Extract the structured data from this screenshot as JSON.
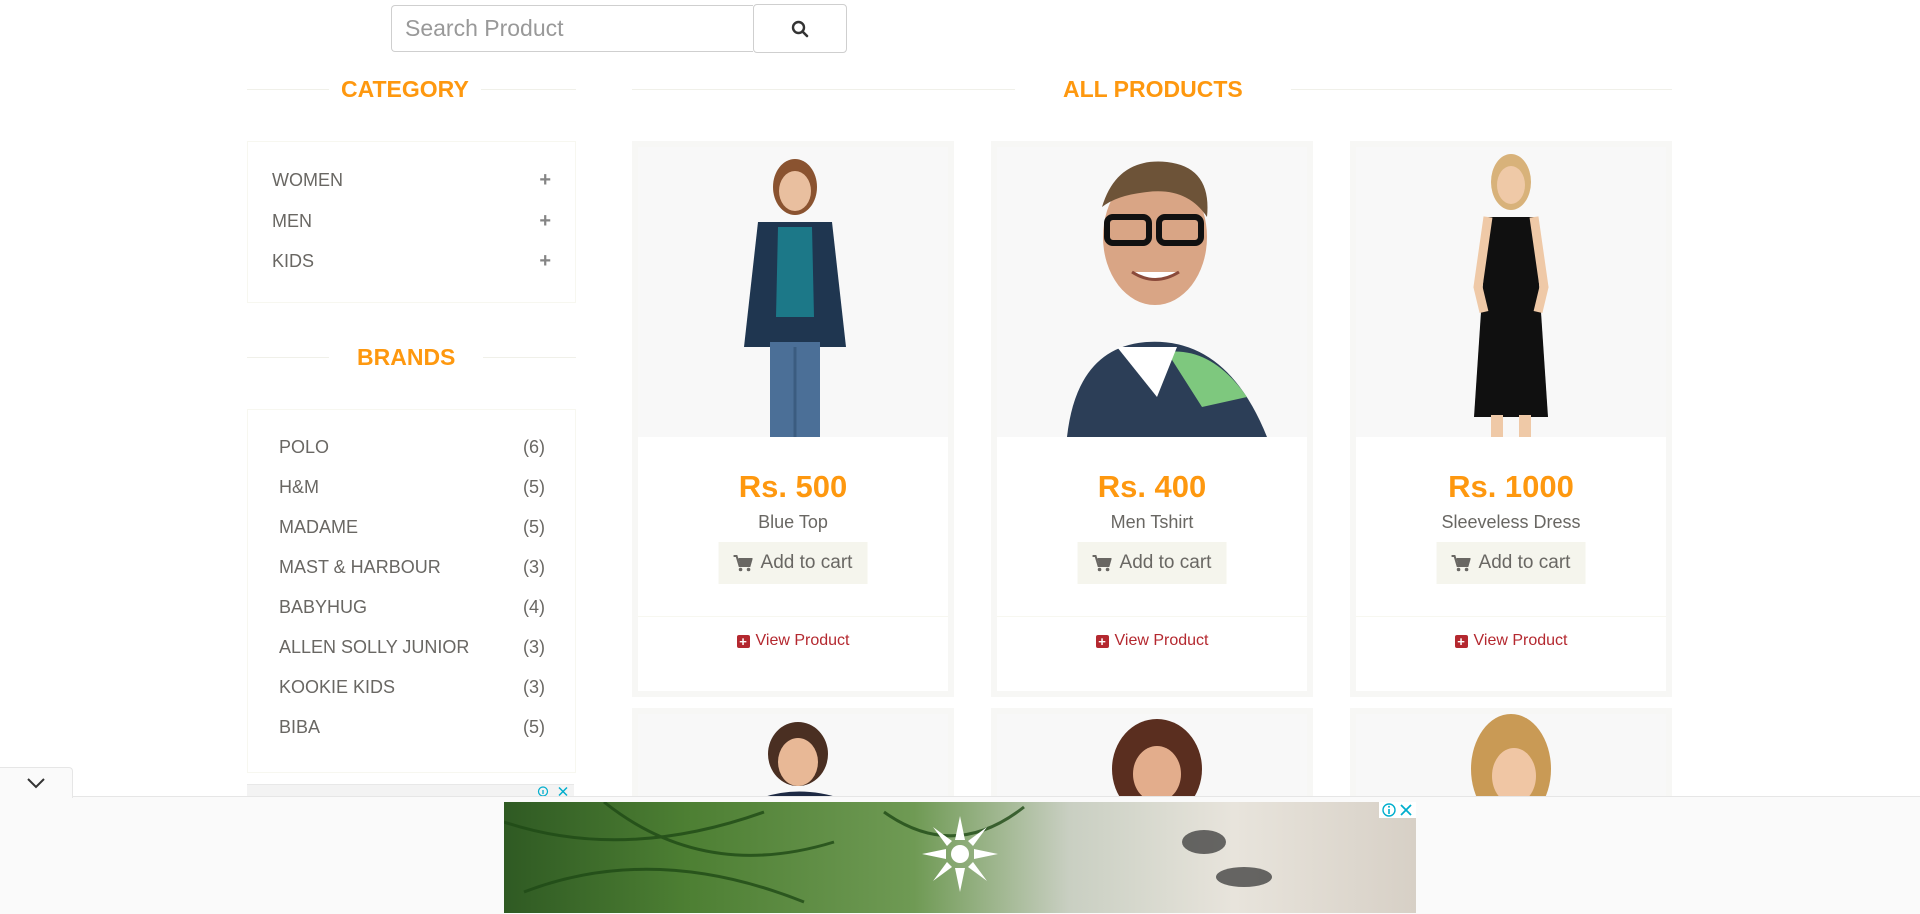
{
  "search": {
    "placeholder": "Search Product",
    "button_icon": "search-icon"
  },
  "sidebar": {
    "category_title": "CATEGORY",
    "categories": [
      {
        "label": "WOMEN",
        "icon": "plus-icon"
      },
      {
        "label": "MEN",
        "icon": "plus-icon"
      },
      {
        "label": "KIDS",
        "icon": "plus-icon"
      }
    ],
    "brands_title": "BRANDS",
    "brands": [
      {
        "label": "POLO",
        "count": "(6)"
      },
      {
        "label": "H&M",
        "count": "(5)"
      },
      {
        "label": "MADAME",
        "count": "(5)"
      },
      {
        "label": "MAST & HARBOUR",
        "count": "(3)"
      },
      {
        "label": "BABYHUG",
        "count": "(4)"
      },
      {
        "label": "ALLEN SOLLY JUNIOR",
        "count": "(3)"
      },
      {
        "label": "KOOKIE KIDS",
        "count": "(3)"
      },
      {
        "label": "BIBA",
        "count": "(5)"
      }
    ]
  },
  "main": {
    "title": "ALL PRODUCTS",
    "products": [
      {
        "price": "Rs. 500",
        "name": "Blue Top",
        "add_label": "Add to cart",
        "view_label": "View Product"
      },
      {
        "price": "Rs. 400",
        "name": "Men Tshirt",
        "add_label": "Add to cart",
        "view_label": "View Product"
      },
      {
        "price": "Rs. 1000",
        "name": "Sleeveless Dress",
        "add_label": "Add to cart",
        "view_label": "View Product"
      }
    ]
  },
  "colors": {
    "accent": "#FE980F",
    "view_link": "#B4282F",
    "text": "#696763"
  }
}
